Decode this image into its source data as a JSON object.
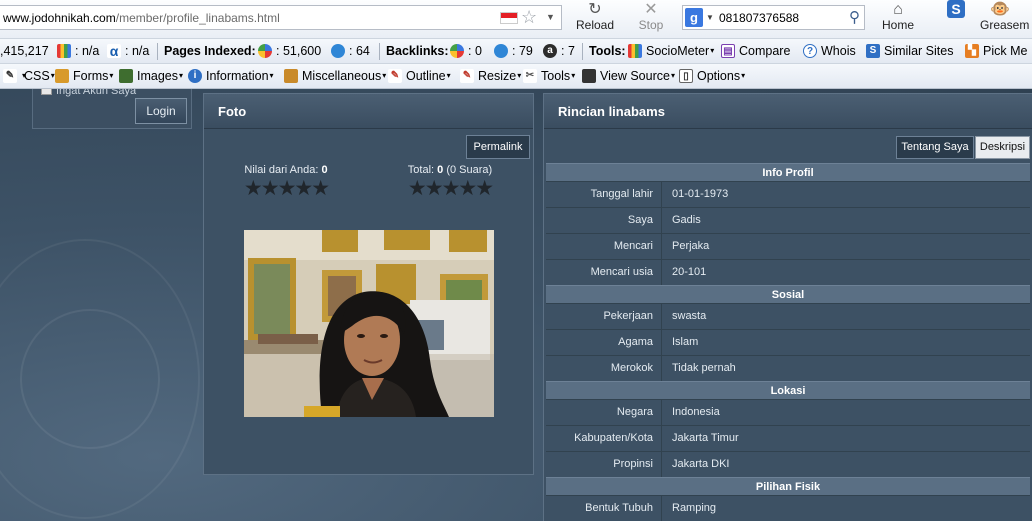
{
  "browser": {
    "url_domain": "www.jodohnikah.com",
    "url_path": "/member/profile_linabams.html",
    "reload_label": "Reload",
    "stop_label": "Stop",
    "search_value": "081807376588",
    "home_label": "Home",
    "greasemonkey_label": "Greasem",
    "search_engine_letter": "g",
    "sitegraph_letter": "S"
  },
  "seo_toolbar": {
    "rank_value": ",415,217",
    "moz_value": ": n/a",
    "alexa_value": ": n/a",
    "pages_indexed_label": "Pages Indexed:",
    "google_indexed": ": 51,600",
    "bing_indexed": ": 64",
    "backlinks_label": "Backlinks:",
    "google_backlinks": ": 0",
    "bing_backlinks": ": 79",
    "alexa_backlinks": ": 7",
    "tools_label": "Tools:",
    "sociometer_label": "SocioMeter",
    "compare_label": "Compare",
    "whois_label": "Whois",
    "similar_label": "Similar Sites",
    "pick_label": "Pick Me"
  },
  "dev_toolbar": {
    "css_label": "CSS",
    "forms_label": "Forms",
    "images_label": "Images",
    "information_label": "Information",
    "misc_label": "Miscellaneous",
    "outline_label": "Outline",
    "resize_label": "Resize",
    "tools_label": "Tools",
    "view_source_label": "View Source",
    "options_label": "Options"
  },
  "login": {
    "remember_label": "Ingat Akun Saya",
    "login_button": "Login"
  },
  "foto": {
    "title": "Foto",
    "permalink_label": "Permalink",
    "my_rating_label": "Nilai dari Anda:",
    "my_rating_value": "0",
    "total_label": "Total:",
    "total_value": "0",
    "total_votes": "(0 Suara)",
    "stars": "★★★★★"
  },
  "details": {
    "title": "Rincian linabams",
    "tab_about": "Tentang Saya",
    "tab_desc": "Deskripsi",
    "sections": [
      {
        "title": "Info Profil",
        "rows": [
          {
            "label": "Tanggal lahir",
            "value": "01-01-1973"
          },
          {
            "label": "Saya",
            "value": "Gadis"
          },
          {
            "label": "Mencari",
            "value": "Perjaka"
          },
          {
            "label": "Mencari usia",
            "value": "20-101"
          }
        ]
      },
      {
        "title": "Sosial",
        "rows": [
          {
            "label": "Pekerjaan",
            "value": "swasta"
          },
          {
            "label": "Agama",
            "value": "Islam"
          },
          {
            "label": "Merokok",
            "value": "Tidak pernah"
          }
        ]
      },
      {
        "title": "Lokasi",
        "rows": [
          {
            "label": "Negara",
            "value": "Indonesia"
          },
          {
            "label": "Kabupaten/Kota",
            "value": "Jakarta Timur"
          },
          {
            "label": "Propinsi",
            "value": "Jakarta DKI"
          }
        ]
      },
      {
        "title": "Pilihan Fisik",
        "rows": [
          {
            "label": "Bentuk Tubuh",
            "value": "Ramping"
          }
        ]
      }
    ]
  }
}
